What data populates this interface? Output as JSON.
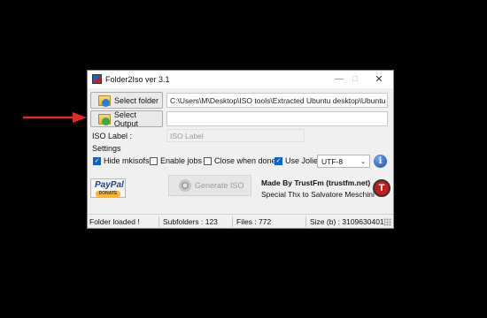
{
  "window": {
    "title": "Folder2Iso ver 3.1"
  },
  "buttons": {
    "select_folder": "Select folder",
    "select_output": "Select Output",
    "generate_iso": "Generate ISO"
  },
  "fields": {
    "folder_path": "C:\\Users\\M\\Desktop\\ISO tools\\Extracted Ubuntu desktop\\Ubuntu d",
    "output_path": "",
    "iso_label_caption": "ISO Label :",
    "iso_label_value": "ISO Label"
  },
  "settings": {
    "heading": "Settings",
    "options": [
      {
        "label": "Hide mkisofs",
        "checked": true
      },
      {
        "label": "Enable jobs",
        "checked": false
      },
      {
        "label": "Close when done",
        "checked": false
      },
      {
        "label": "Use Joliet",
        "checked": true
      }
    ],
    "encoding": "UTF-8"
  },
  "paypal": {
    "logo_text": "PayPal",
    "donate_text": "DONATE"
  },
  "credits": {
    "made_by": "Made By TrustFm (trustfm.net)",
    "special_thanks": "Special Thx to Salvatore Meschini",
    "logo_letter": "T"
  },
  "status": {
    "state": "Folder loaded !",
    "subfolders": "Subfolders : 123",
    "files": "Files : 772",
    "size": "Size (b) : 3109630401"
  },
  "colors": {
    "arrow": "#e02b2b",
    "checkbox_checked": "#0a64c8",
    "info_icon": "#1a4fa0"
  },
  "icons": {
    "app": "folder2iso-app-icon",
    "folder_select": "folder-icon",
    "output_select": "folder-output-icon",
    "info": "info-icon",
    "generate": "disc-icon",
    "credits_logo": "trustfm-logo"
  }
}
